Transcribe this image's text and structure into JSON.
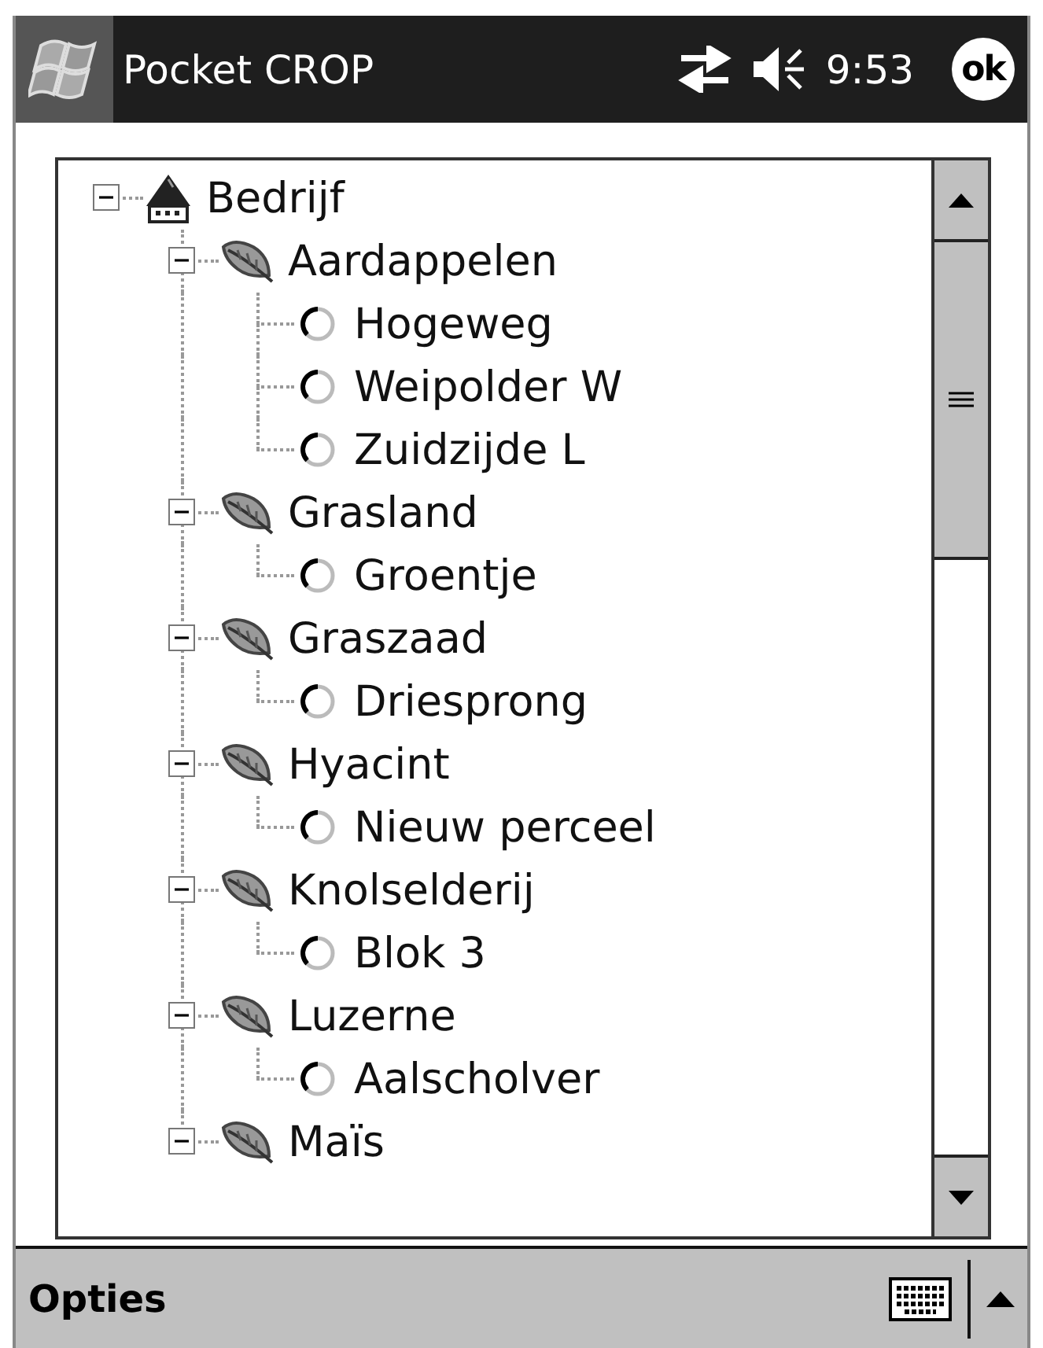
{
  "title_bar": {
    "title": "Pocket CROP",
    "time": "9:53",
    "ok": "ok"
  },
  "tree": [
    {
      "kind": "farm",
      "label": "Bedrijf",
      "expanded": true,
      "children": [
        {
          "kind": "crop",
          "label": "Aardappelen",
          "expanded": true,
          "children": [
            {
              "kind": "field",
              "label": "Hogeweg"
            },
            {
              "kind": "field",
              "label": "Weipolder W"
            },
            {
              "kind": "field",
              "label": "Zuidzijde L"
            }
          ]
        },
        {
          "kind": "crop",
          "label": "Grasland",
          "expanded": true,
          "children": [
            {
              "kind": "field",
              "label": "Groentje"
            }
          ]
        },
        {
          "kind": "crop",
          "label": "Graszaad",
          "expanded": true,
          "children": [
            {
              "kind": "field",
              "label": "Driesprong"
            }
          ]
        },
        {
          "kind": "crop",
          "label": "Hyacint",
          "expanded": true,
          "children": [
            {
              "kind": "field",
              "label": "Nieuw perceel"
            }
          ]
        },
        {
          "kind": "crop",
          "label": "Knolselderij",
          "expanded": true,
          "children": [
            {
              "kind": "field",
              "label": "Blok 3"
            }
          ]
        },
        {
          "kind": "crop",
          "label": "Luzerne",
          "expanded": true,
          "children": [
            {
              "kind": "field",
              "label": "Aalscholver"
            }
          ]
        },
        {
          "kind": "crop",
          "label": "Maïs",
          "expanded": true
        }
      ]
    }
  ],
  "menu_bar": {
    "label": "Opties"
  }
}
